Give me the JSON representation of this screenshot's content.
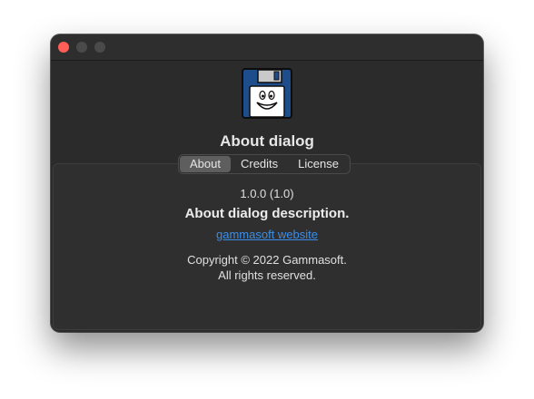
{
  "window": {
    "title": "About dialog"
  },
  "tabs": [
    {
      "label": "About",
      "active": true
    },
    {
      "label": "Credits",
      "active": false
    },
    {
      "label": "License",
      "active": false
    }
  ],
  "about": {
    "version": "1.0.0 (1.0)",
    "description": "About dialog description.",
    "website_label": "gammasoft website",
    "copyright_line1": "Copyright © 2022 Gammasoft.",
    "copyright_line2": "All rights reserved."
  },
  "icons": {
    "app_icon": "floppy-disk-smiley-icon"
  },
  "colors": {
    "window_bg": "#2b2b2b",
    "close": "#ff5f57",
    "link": "#3b8eea",
    "floppy_blue": "#1e4d8c"
  }
}
